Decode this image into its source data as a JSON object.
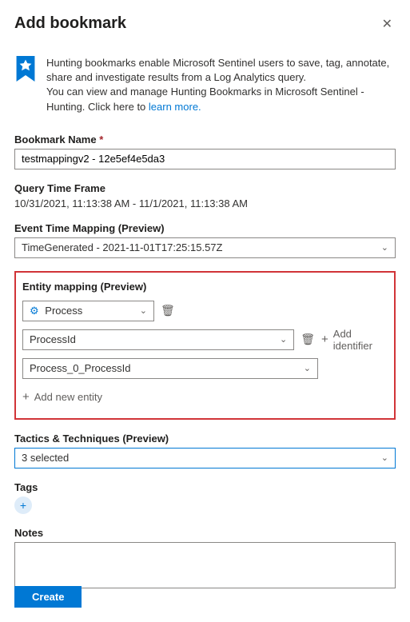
{
  "title": "Add bookmark",
  "info": {
    "line1": "Hunting bookmarks enable Microsoft Sentinel users to save, tag, annotate, share and investigate results from a Log Analytics query.",
    "line2": "You can view and manage Hunting Bookmarks in Microsoft Sentinel - Hunting. Click here to ",
    "link": "learn more."
  },
  "bookmarkName": {
    "label": "Bookmark Name ",
    "value": "testmappingv2 - 12e5ef4e5da3"
  },
  "queryTimeFrame": {
    "label": "Query Time Frame",
    "value": "10/31/2021, 11:13:38 AM - 11/1/2021, 11:13:38 AM"
  },
  "eventTimeMapping": {
    "label": "Event Time Mapping (Preview)",
    "value": "TimeGenerated - 2021-11-01T17:25:15.57Z"
  },
  "entityMapping": {
    "label": "Entity mapping (Preview)",
    "entityType": "Process",
    "identifier": "ProcessId",
    "field": "Process_0_ProcessId",
    "addIdentifier": "Add identifier",
    "addEntity": "Add new entity"
  },
  "tactics": {
    "label": "Tactics & Techniques (Preview)",
    "value": "3 selected"
  },
  "tags": {
    "label": "Tags"
  },
  "notes": {
    "label": "Notes"
  },
  "createButton": "Create"
}
